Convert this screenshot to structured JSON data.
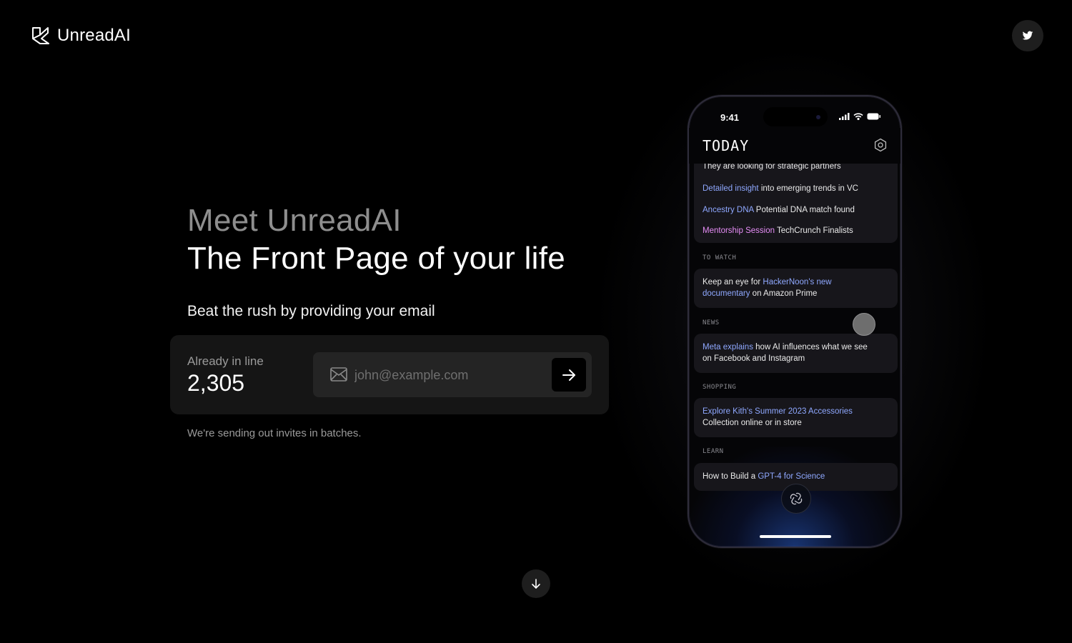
{
  "header": {
    "brand_name": "UnreadAI",
    "twitter_icon": "twitter-icon"
  },
  "hero": {
    "kicker": "Meet UnreadAI",
    "title": "The Front Page of your life",
    "subtitle": "Beat the rush by providing your email"
  },
  "signup": {
    "queue_label": "Already in line",
    "queue_count": "2,305",
    "email_placeholder": "john@example.com",
    "email_value": "",
    "mail_icon": "mail-icon",
    "submit_icon": "arrow-right-icon",
    "note": "We're sending out invites in batches."
  },
  "scroll_icon": "arrow-down-icon",
  "phone": {
    "status_time": "9:41",
    "title": "TODAY",
    "top_card": {
      "line1": "They are looking for strategic partners",
      "line2_highlight": "Detailed insight",
      "line2_rest": " into emerging trends in VC",
      "line3_highlight": "Ancestry DNA",
      "line3_rest": " Potential DNA match found",
      "line4_highlight": "Mentorship Session",
      "line4_rest": " TechCrunch Finalists"
    },
    "to_watch": {
      "label": "TO WATCH",
      "line1_pre": "Keep an eye for ",
      "line1_highlight": "HackerNoon's new",
      "line2_highlight": "documentary",
      "line2_rest": " on Amazon Prime"
    },
    "news": {
      "label": "NEWS",
      "line1_highlight": "Meta explains",
      "line1_rest": " how AI influences what we see",
      "line2": "on Facebook and Instagram"
    },
    "shopping": {
      "label": "SHOPPING",
      "line1_highlight": "Explore Kith's Summer 2023 Accessories",
      "line2": "Collection online or in store"
    },
    "learn": {
      "label": "LEARN",
      "line1_pre": "How to Build a ",
      "line1_highlight": "GPT-4 for Science"
    }
  },
  "colors": {
    "background": "#000000",
    "accent_blue": "#8fa8ff",
    "accent_pink": "#e58df5",
    "card": "#151515"
  }
}
